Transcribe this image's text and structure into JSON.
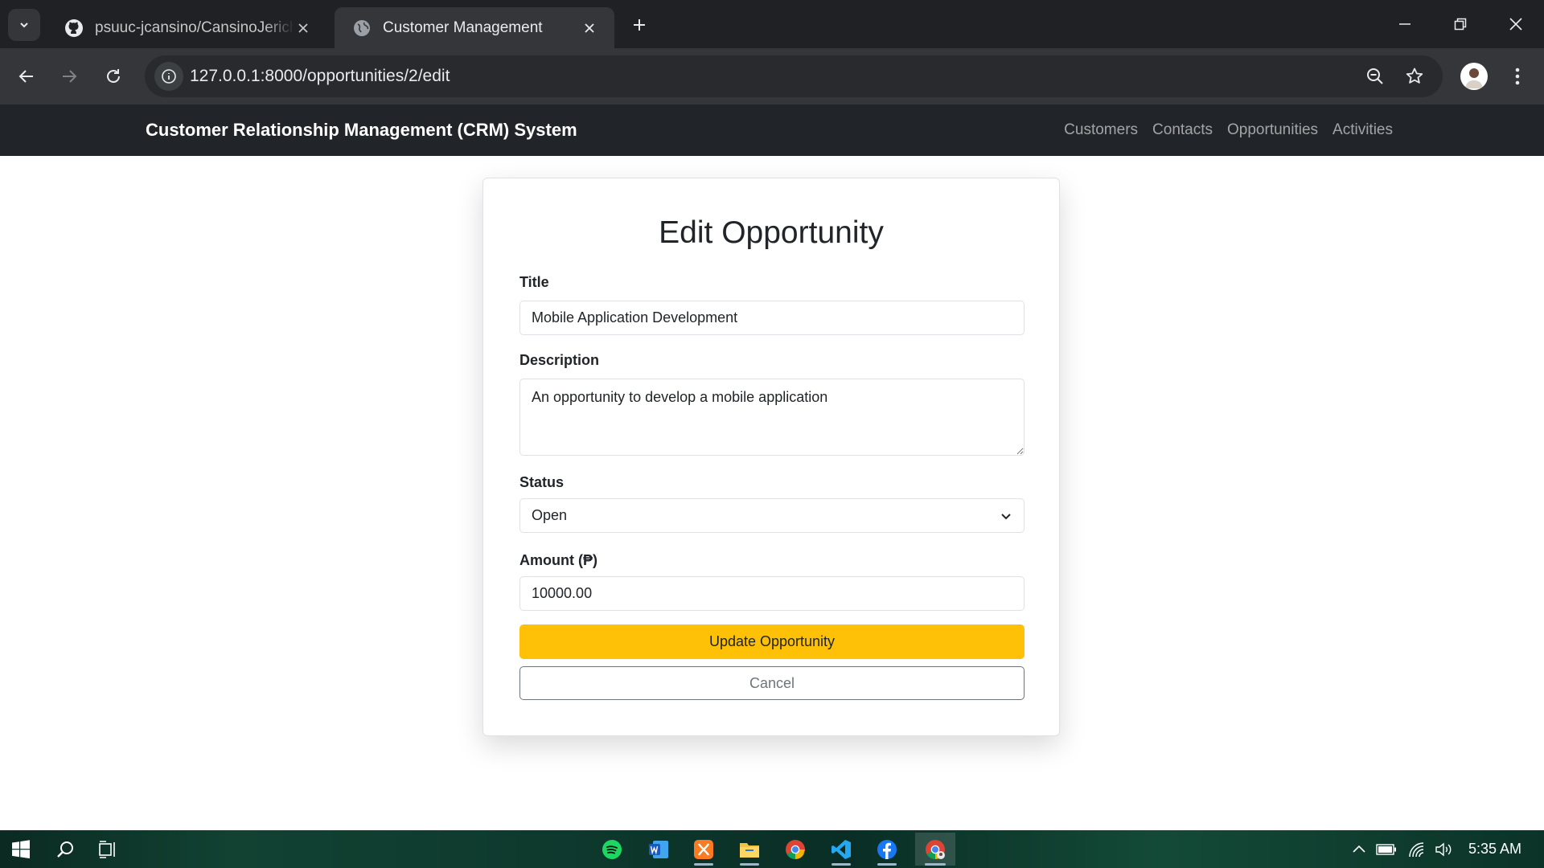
{
  "browser": {
    "tabs": [
      {
        "title": "psuuc-jcansino/CansinoJericho",
        "icon": "github-icon",
        "active": false
      },
      {
        "title": "Customer Management",
        "icon": "globe-icon",
        "active": true
      }
    ],
    "url": "127.0.0.1:8000/opportunities/2/edit"
  },
  "navbar": {
    "brand": "Customer Relationship Management (CRM) System",
    "links": [
      "Customers",
      "Contacts",
      "Opportunities",
      "Activities"
    ]
  },
  "form": {
    "heading": "Edit Opportunity",
    "title_label": "Title",
    "title_value": "Mobile Application Development",
    "description_label": "Description",
    "description_value": "An opportunity to develop a mobile application",
    "status_label": "Status",
    "status_value": "Open",
    "amount_label": "Amount (₱)",
    "amount_value": "10000.00",
    "update_button": "Update Opportunity",
    "cancel_button": "Cancel"
  },
  "taskbar": {
    "apps": [
      "spotify-icon",
      "word-icon",
      "xampp-icon",
      "file-explorer-icon",
      "chrome-icon",
      "vscode-icon",
      "facebook-icon",
      "chrome-profile-icon"
    ],
    "time": "5:35 AM"
  },
  "colors": {
    "navbar_bg": "#212529",
    "update_button": "#ffc107",
    "chrome_dark": "#202124"
  }
}
